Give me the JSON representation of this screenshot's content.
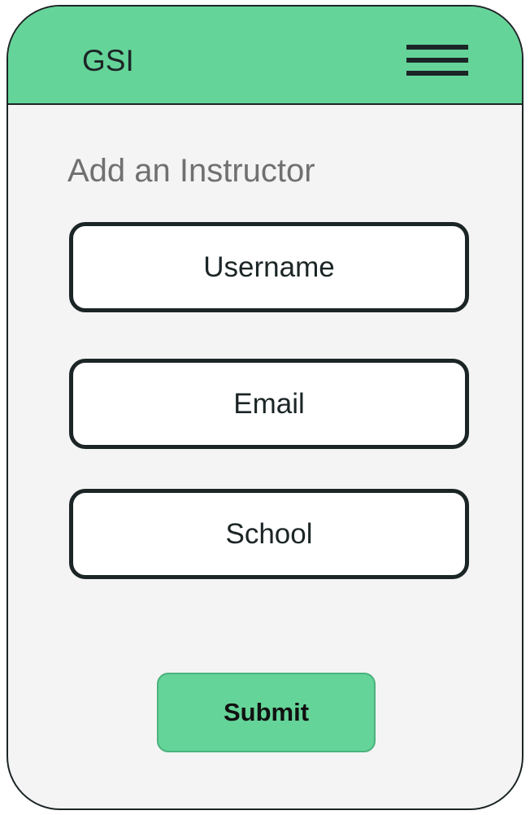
{
  "header": {
    "title": "GSI",
    "menu_icon": "hamburger-menu-icon",
    "background_color": "#65d499"
  },
  "main": {
    "page_title": "Add an Instructor",
    "fields": [
      {
        "placeholder": "Username",
        "value": ""
      },
      {
        "placeholder": "Email",
        "value": ""
      },
      {
        "placeholder": "School",
        "value": ""
      }
    ],
    "submit_label": "Submit"
  },
  "colors": {
    "accent": "#65d499",
    "border": "#1c2526",
    "screen_background": "#f4f4f4",
    "title_text": "#707070"
  }
}
